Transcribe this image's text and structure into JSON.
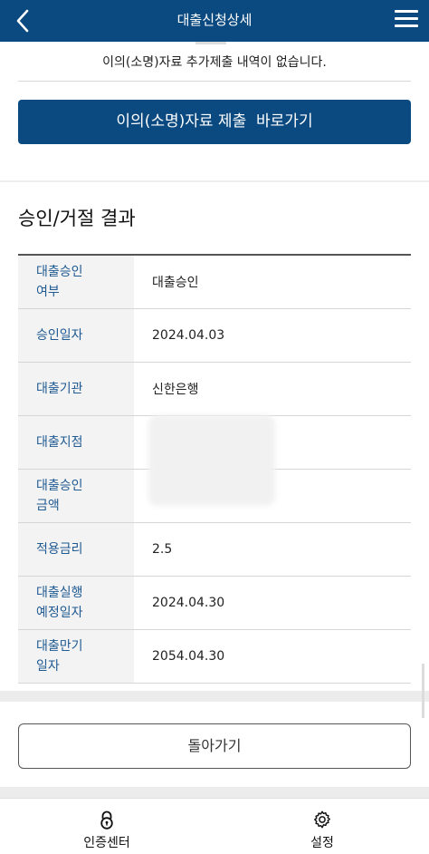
{
  "header": {
    "title": "대출신청상세"
  },
  "objection": {
    "notice": "이의(소명)자료 추가제출 내역이 없습니다.",
    "submit_button": "이의(소명)자료 제출  바로가기"
  },
  "result": {
    "section_title": "승인/거절 결과",
    "rows": [
      {
        "label": "대출승인\n여부",
        "value": "대출승인"
      },
      {
        "label": "승인일자",
        "value": "2024.04.03"
      },
      {
        "label": "대출기관",
        "value": "신한은행"
      },
      {
        "label": "대출지점",
        "value": ""
      },
      {
        "label": "대출승인\n금액",
        "value": ""
      },
      {
        "label": "적용금리",
        "value": "2.5"
      },
      {
        "label": "대출실행\n예정일자",
        "value": "2024.04.30"
      },
      {
        "label": "대출만기\n일자",
        "value": "2054.04.30"
      }
    ]
  },
  "back_button": "돌아가기",
  "bottom_nav": {
    "items": [
      {
        "label": "인증센터",
        "icon": "lock-icon"
      },
      {
        "label": "설정",
        "icon": "gear-icon"
      }
    ]
  },
  "colors": {
    "brand": "#0b4a80",
    "label_text": "#1f5a92"
  }
}
